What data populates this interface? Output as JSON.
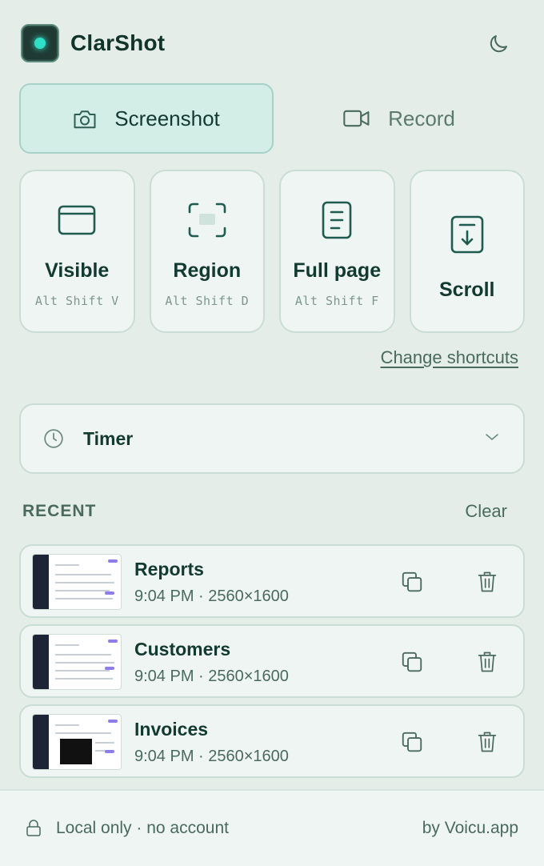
{
  "app": {
    "title": "ClarShot"
  },
  "colors": {
    "accent": "#2fe0c8",
    "active_tab_bg": "#d3ede7",
    "text_primary": "#133a30",
    "text_muted": "#4a6a60"
  },
  "header": {
    "theme_icon": "moon-icon"
  },
  "tabs": [
    {
      "label": "Screenshot",
      "icon": "camera-icon",
      "active": true
    },
    {
      "label": "Record",
      "icon": "video-icon",
      "active": false
    }
  ],
  "capture_modes": [
    {
      "label": "Visible",
      "shortcut": "Alt Shift V",
      "icon": "window-icon"
    },
    {
      "label": "Region",
      "shortcut": "Alt Shift D",
      "icon": "region-select-icon"
    },
    {
      "label": "Full page",
      "shortcut": "Alt Shift F",
      "icon": "document-icon"
    },
    {
      "label": "Scroll",
      "shortcut": "",
      "icon": "scroll-capture-icon"
    }
  ],
  "change_shortcuts_label": "Change shortcuts",
  "timer": {
    "label": "Timer",
    "icon": "clock-icon"
  },
  "recent": {
    "title": "RECENT",
    "clear_label": "Clear",
    "items": [
      {
        "name": "Reports",
        "meta": "9:04 PM · 2560×1600"
      },
      {
        "name": "Customers",
        "meta": "9:04 PM · 2560×1600"
      },
      {
        "name": "Invoices",
        "meta": "9:04 PM · 2560×1600"
      }
    ]
  },
  "footer": {
    "local_label": "Local only · no account",
    "by_label": "by Voicu.app"
  }
}
